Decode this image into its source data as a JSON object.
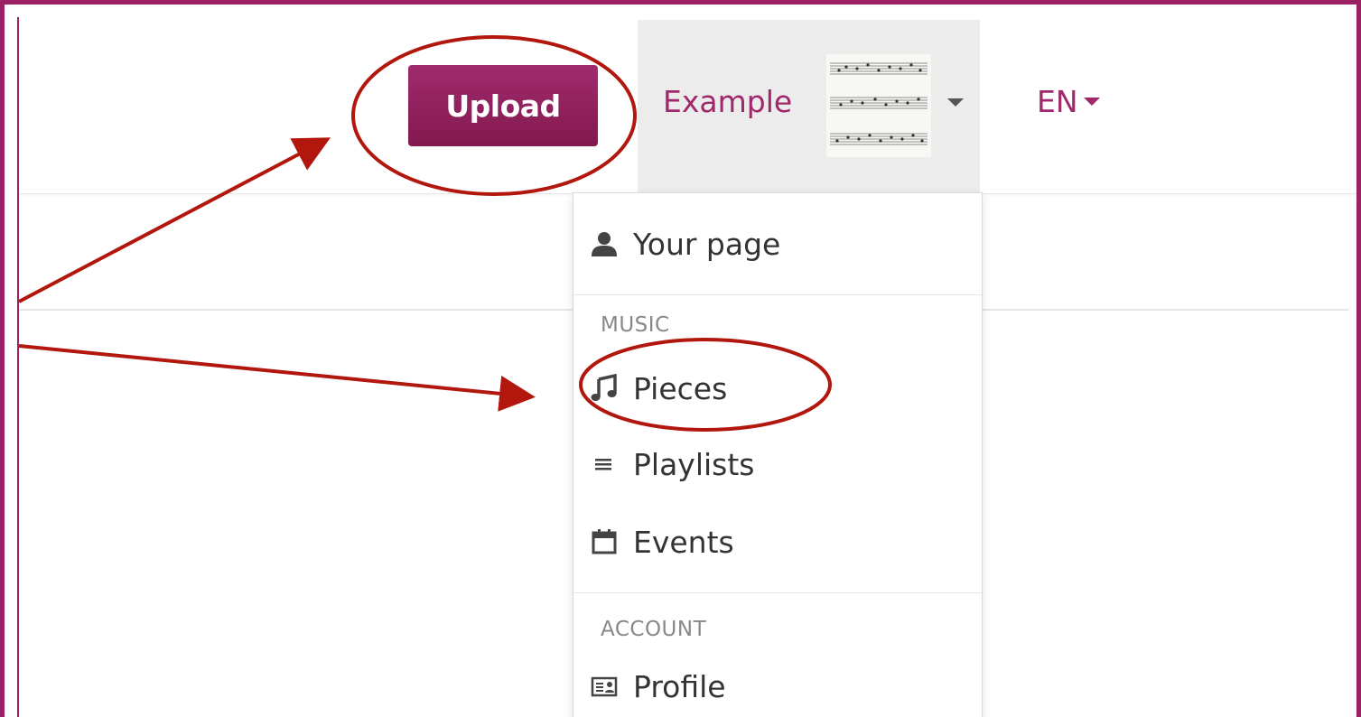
{
  "navbar": {
    "upload_label": "Upload",
    "user_name": "Example",
    "language": "EN"
  },
  "menu": {
    "your_page_label": "Your page",
    "music_header": "MUSIC",
    "pieces_label": "Pieces",
    "playlists_label": "Playlists",
    "events_label": "Events",
    "account_header": "ACCOUNT",
    "profile_label": "Profile"
  },
  "icons": {
    "your_page": "user-icon",
    "pieces": "music-note-icon",
    "playlists": "list-icon",
    "events": "calendar-icon",
    "profile": "id-card-icon",
    "avatar": "sheet-music-thumbnail"
  },
  "colors": {
    "brand": "#9c2164",
    "annotation": "#b2170e"
  }
}
